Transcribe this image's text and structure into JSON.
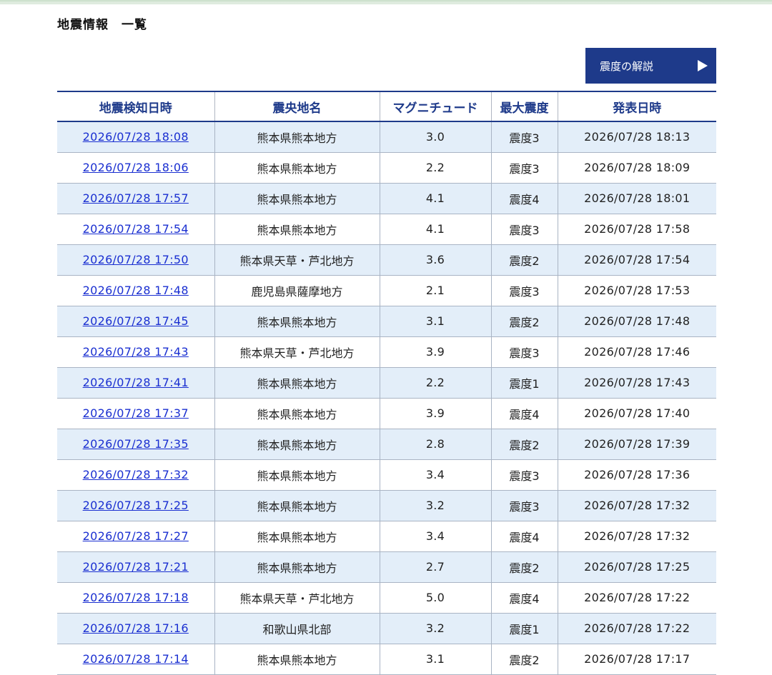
{
  "page": {
    "title": "地震情報　一覧"
  },
  "guide_button": {
    "label": "震度の解説"
  },
  "table": {
    "headers": [
      "地震検知日時",
      "震央地名",
      "マグニチュード",
      "最大震度",
      "発表日時"
    ],
    "rows": [
      {
        "detected": "2026/07/28 18:08",
        "epicenter": "熊本県熊本地方",
        "magnitude": "3.0",
        "max_intensity": "震度3",
        "issued": "2026/07/28 18:13"
      },
      {
        "detected": "2026/07/28 18:06",
        "epicenter": "熊本県熊本地方",
        "magnitude": "2.2",
        "max_intensity": "震度3",
        "issued": "2026/07/28 18:09"
      },
      {
        "detected": "2026/07/28 17:57",
        "epicenter": "熊本県熊本地方",
        "magnitude": "4.1",
        "max_intensity": "震度4",
        "issued": "2026/07/28 18:01"
      },
      {
        "detected": "2026/07/28 17:54",
        "epicenter": "熊本県熊本地方",
        "magnitude": "4.1",
        "max_intensity": "震度3",
        "issued": "2026/07/28 17:58"
      },
      {
        "detected": "2026/07/28 17:50",
        "epicenter": "熊本県天草・芦北地方",
        "magnitude": "3.6",
        "max_intensity": "震度2",
        "issued": "2026/07/28 17:54"
      },
      {
        "detected": "2026/07/28 17:48",
        "epicenter": "鹿児島県薩摩地方",
        "magnitude": "2.1",
        "max_intensity": "震度3",
        "issued": "2026/07/28 17:53"
      },
      {
        "detected": "2026/07/28 17:45",
        "epicenter": "熊本県熊本地方",
        "magnitude": "3.1",
        "max_intensity": "震度2",
        "issued": "2026/07/28 17:48"
      },
      {
        "detected": "2026/07/28 17:43",
        "epicenter": "熊本県天草・芦北地方",
        "magnitude": "3.9",
        "max_intensity": "震度3",
        "issued": "2026/07/28 17:46"
      },
      {
        "detected": "2026/07/28 17:41",
        "epicenter": "熊本県熊本地方",
        "magnitude": "2.2",
        "max_intensity": "震度1",
        "issued": "2026/07/28 17:43"
      },
      {
        "detected": "2026/07/28 17:37",
        "epicenter": "熊本県熊本地方",
        "magnitude": "3.9",
        "max_intensity": "震度4",
        "issued": "2026/07/28 17:40"
      },
      {
        "detected": "2026/07/28 17:35",
        "epicenter": "熊本県熊本地方",
        "magnitude": "2.8",
        "max_intensity": "震度2",
        "issued": "2026/07/28 17:39"
      },
      {
        "detected": "2026/07/28 17:32",
        "epicenter": "熊本県熊本地方",
        "magnitude": "3.4",
        "max_intensity": "震度3",
        "issued": "2026/07/28 17:36"
      },
      {
        "detected": "2026/07/28 17:25",
        "epicenter": "熊本県熊本地方",
        "magnitude": "3.2",
        "max_intensity": "震度3",
        "issued": "2026/07/28 17:32"
      },
      {
        "detected": "2026/07/28 17:27",
        "epicenter": "熊本県熊本地方",
        "magnitude": "3.4",
        "max_intensity": "震度4",
        "issued": "2026/07/28 17:32"
      },
      {
        "detected": "2026/07/28 17:21",
        "epicenter": "熊本県熊本地方",
        "magnitude": "2.7",
        "max_intensity": "震度2",
        "issued": "2026/07/28 17:25"
      },
      {
        "detected": "2026/07/28 17:18",
        "epicenter": "熊本県天草・芦北地方",
        "magnitude": "5.0",
        "max_intensity": "震度4",
        "issued": "2026/07/28 17:22"
      },
      {
        "detected": "2026/07/28 17:16",
        "epicenter": "和歌山県北部",
        "magnitude": "3.2",
        "max_intensity": "震度1",
        "issued": "2026/07/28 17:22"
      },
      {
        "detected": "2026/07/28 17:14",
        "epicenter": "熊本県熊本地方",
        "magnitude": "3.1",
        "max_intensity": "震度2",
        "issued": "2026/07/28 17:17"
      }
    ]
  }
}
